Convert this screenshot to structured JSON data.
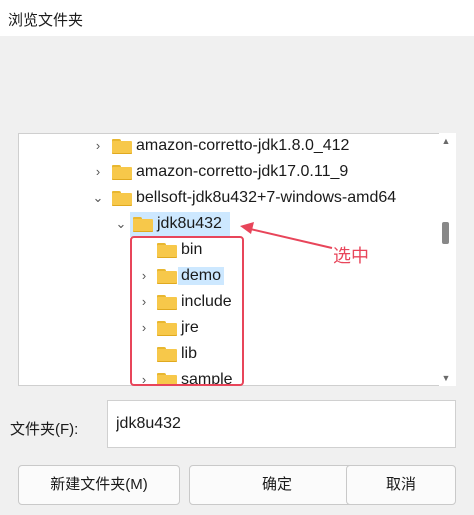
{
  "window": {
    "title": "浏览文件夹"
  },
  "tree": {
    "rows": [
      {
        "label": "amazon-corretto-jdk1.8.0_412",
        "expander": "›"
      },
      {
        "label": "amazon-corretto-jdk17.0.11_9",
        "expander": "›"
      },
      {
        "label": "bellsoft-jdk8u432+7-windows-amd64",
        "expander": "⌄"
      },
      {
        "label": "jdk8u432",
        "expander": "⌄",
        "selected": true
      },
      {
        "label": "bin",
        "expander": ""
      },
      {
        "label": "demo",
        "expander": "›"
      },
      {
        "label": "include",
        "expander": "›"
      },
      {
        "label": "jre",
        "expander": "›"
      },
      {
        "label": "lib",
        "expander": ""
      },
      {
        "label": "sample",
        "expander": "›"
      }
    ]
  },
  "annotation": {
    "text": "选中",
    "color": "#e8455a"
  },
  "folder_field": {
    "label": "文件夹(F):",
    "value": "jdk8u432"
  },
  "buttons": {
    "new_folder": "新建文件夹(M)",
    "ok": "确定",
    "cancel": "取消"
  },
  "colors": {
    "selection": "#cde8ff",
    "annotation": "#e8455a",
    "folder": "#f7c84a"
  }
}
